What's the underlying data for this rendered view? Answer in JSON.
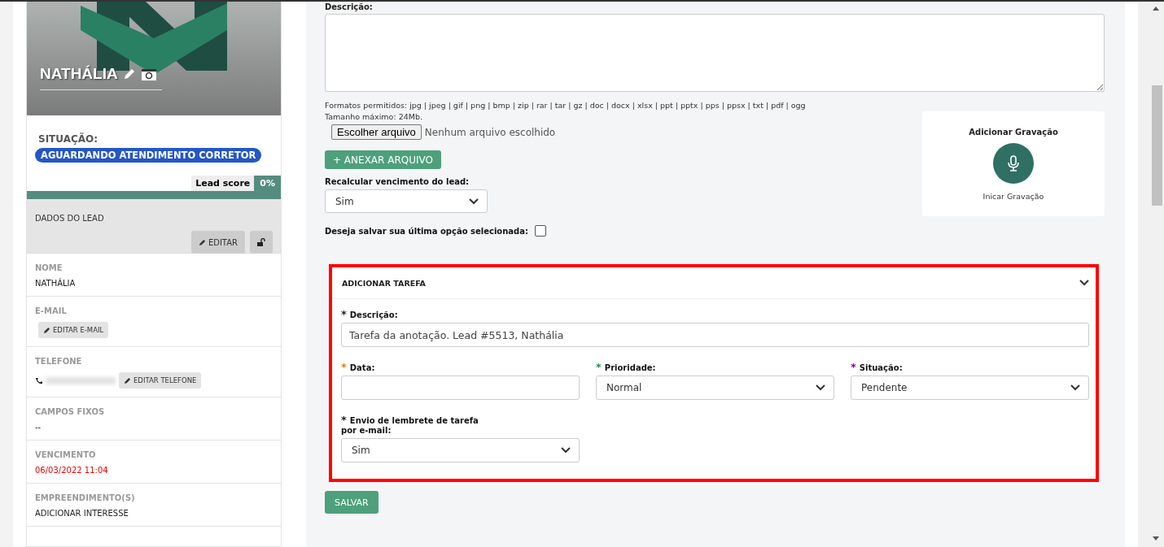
{
  "profile": {
    "name": "NATHÁLIA"
  },
  "status": {
    "label": "SITUAÇÃO:",
    "badge": "AGUARDANDO ATENDIMENTO CORRETOR"
  },
  "lead_score": {
    "label": "Lead score",
    "value": "0%"
  },
  "lead_data": {
    "title": "DADOS DO LEAD",
    "edit_button": "EDITAR",
    "fields": [
      {
        "kind": "text",
        "label": "NOME",
        "value": "NATHÁLIA"
      },
      {
        "kind": "button",
        "label": "E-MAIL",
        "button": "EDITAR E-MAIL"
      },
      {
        "kind": "phone",
        "label": "TELEFONE",
        "button": "EDITAR TELEFONE"
      },
      {
        "kind": "text",
        "label": "CAMPOS FIXOS",
        "value": "--"
      },
      {
        "kind": "alert",
        "label": "VENCIMENTO",
        "value": "06/03/2022 11:04"
      },
      {
        "kind": "text",
        "label": "EMPREENDIMENTO(S)",
        "value": "ADICIONAR INTERESSE"
      }
    ]
  },
  "note": {
    "label": "Descrição:",
    "formats": "Formatos permitidos: jpg | jpeg | gif | png | bmp | zip | rar | tar | gz | doc | docx | xlsx | ppt | pptx | pps | ppsx | txt | pdf | ogg",
    "max_size": "Tamanho máximo: 24Mb.",
    "file_button": "Escolher arquivo",
    "file_status": "Nenhum arquivo escolhido",
    "attach_button": "+ ANEXAR ARQUIVO",
    "recalc": {
      "label": "Recalcular vencimento do lead:",
      "value": "Sim"
    },
    "save_option": {
      "label": "Deseja salvar sua última opção selecionada:",
      "checked": false
    }
  },
  "recording": {
    "title": "Adicionar Gravação",
    "caption": "Inicar Gravação"
  },
  "task": {
    "title": "ADICIONAR TAREFA",
    "highlighted": true,
    "fields": [
      {
        "kind": "input",
        "mark": "*",
        "color": "#222222",
        "label": "Descrição:",
        "value": "Tarefa da anotação. Lead #5513, Nathália"
      },
      {
        "kind": "input",
        "mark": "*",
        "color": "#e67e00",
        "label": "Data:"
      },
      {
        "kind": "select",
        "mark": "*",
        "color": "#2e8b57",
        "label": "Prioridade:",
        "value": "Normal"
      },
      {
        "kind": "select",
        "mark": "*",
        "color": "#8b008b",
        "label": "Situação:",
        "value": "Pendente"
      },
      {
        "kind": "select",
        "mark": "*",
        "color": "#222222",
        "label": "Envio de lembrete de tarefa por e-mail:",
        "value": "Sim"
      }
    ]
  },
  "save_button": "SALVAR"
}
